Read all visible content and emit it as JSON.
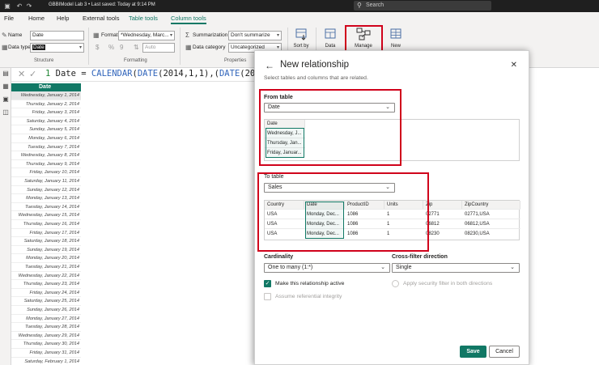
{
  "titlebar": {
    "title": "GBBIModel Lab 3 • Last saved: Today at 9:14 PM",
    "search_placeholder": "Search"
  },
  "menu": {
    "tabs": [
      "File",
      "Home",
      "Help",
      "External tools",
      "Table tools",
      "Column tools"
    ]
  },
  "ribbon": {
    "name_label": "Name",
    "name_value": "Date",
    "datatype_label": "Data type",
    "datatype_value": "Date",
    "format_label": "Format",
    "format_value": "*Wednesday, Marc...",
    "currency_symbol": "$",
    "percent_symbol": "%",
    "comma_symbol": "9",
    "decimals_value": "Auto",
    "summarization_label": "Summarization",
    "summarization_value": "Don't summarize",
    "category_label": "Data category",
    "category_value": "Uncategorized",
    "groups": [
      "Structure",
      "Formatting",
      "Properties"
    ],
    "sort_by_label": "Sort by",
    "data_label": "Data",
    "manage_label": "Manage",
    "new_label": "New"
  },
  "formula": {
    "line_no": "1",
    "text_prefix": "Date = ",
    "text_fn1": "CALENDAR",
    "text_mid1": "(",
    "text_fn2": "DATE",
    "text_args": "(2014,1,1),(",
    "text_fn3": "DATE",
    "text_tail": "(202"
  },
  "table": {
    "column_header": "Date",
    "rows": [
      "Wednesday, January 1, 2014",
      "Thursday, January 2, 2014",
      "Friday, January 3, 2014",
      "Saturday, January 4, 2014",
      "Sunday, January 5, 2014",
      "Monday, January 6, 2014",
      "Tuesday, January 7, 2014",
      "Wednesday, January 8, 2014",
      "Thursday, January 9, 2014",
      "Friday, January 10, 2014",
      "Saturday, January 11, 2014",
      "Sunday, January 12, 2014",
      "Monday, January 13, 2014",
      "Tuesday, January 14, 2014",
      "Wednesday, January 15, 2014",
      "Thursday, January 16, 2014",
      "Friday, January 17, 2014",
      "Saturday, January 18, 2014",
      "Sunday, January 19, 2014",
      "Monday, January 20, 2014",
      "Tuesday, January 21, 2014",
      "Wednesday, January 22, 2014",
      "Thursday, January 23, 2014",
      "Friday, January 24, 2014",
      "Saturday, January 25, 2014",
      "Sunday, January 26, 2014",
      "Monday, January 27, 2014",
      "Tuesday, January 28, 2014",
      "Wednesday, January 29, 2014",
      "Thursday, January 30, 2014",
      "Friday, January 31, 2014",
      "Saturday, February 1, 2014"
    ]
  },
  "dialog": {
    "title": "New relationship",
    "subtitle": "Select tables and columns that are related.",
    "from_label": "From table",
    "from_value": "Date",
    "from_preview": {
      "header": "Date",
      "rows": [
        "Wednesday, J...",
        "Thursday, Jan...",
        "Friday, Januar..."
      ]
    },
    "to_label": "To table",
    "to_value": "Sales",
    "to_preview": {
      "headers": [
        "Country",
        "Date",
        "ProductID",
        "Units",
        "Zip",
        "ZipCountry"
      ],
      "rows": [
        [
          "USA",
          "Monday, Dec...",
          "1086",
          "1",
          "02771",
          "02771,USA"
        ],
        [
          "USA",
          "Monday, Dec...",
          "1086",
          "1",
          "06812",
          "06812,USA"
        ],
        [
          "USA",
          "Monday, Dec...",
          "1086",
          "1",
          "08230",
          "08230,USA"
        ]
      ]
    },
    "cardinality_label": "Cardinality",
    "cardinality_value": "One to many (1:*)",
    "crossfilter_label": "Cross-filter direction",
    "crossfilter_value": "Single",
    "make_active_label": "Make this relationship active",
    "security_label": "Apply security filter in both directions",
    "integrity_label": "Assume referential integrity",
    "save_label": "Save",
    "cancel_label": "Cancel"
  },
  "colors": {
    "accent": "#117865",
    "highlight": "#d0021b"
  }
}
